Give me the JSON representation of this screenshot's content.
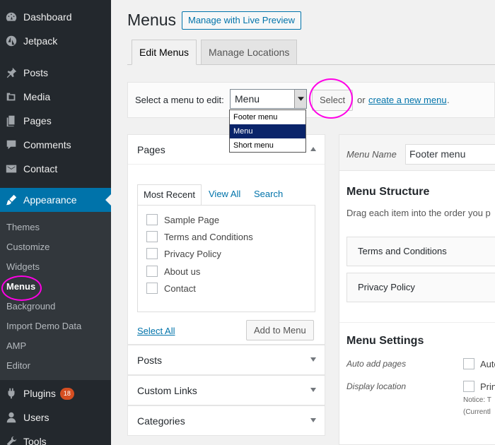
{
  "sidebar": {
    "items": [
      {
        "label": "Dashboard",
        "icon": "dashboard-icon"
      },
      {
        "label": "Jetpack",
        "icon": "jetpack-icon"
      },
      {
        "label": "Posts",
        "icon": "pin-icon"
      },
      {
        "label": "Media",
        "icon": "media-icon"
      },
      {
        "label": "Pages",
        "icon": "pages-icon"
      },
      {
        "label": "Comments",
        "icon": "comments-icon"
      },
      {
        "label": "Contact",
        "icon": "mail-icon"
      },
      {
        "label": "Appearance",
        "icon": "brush-icon"
      },
      {
        "label": "Plugins",
        "icon": "plugin-icon",
        "badge": "18"
      },
      {
        "label": "Users",
        "icon": "user-icon"
      },
      {
        "label": "Tools",
        "icon": "wrench-icon"
      }
    ],
    "appearance_submenu": [
      "Themes",
      "Customize",
      "Widgets",
      "Menus",
      "Background",
      "Import Demo Data",
      "AMP",
      "Editor"
    ]
  },
  "header": {
    "title": "Menus",
    "live_preview": "Manage with Live Preview"
  },
  "tabs": [
    "Edit Menus",
    "Manage Locations"
  ],
  "select_bar": {
    "label": "Select a menu to edit:",
    "current": "Menu",
    "options": [
      "Footer menu",
      "Menu",
      "Short menu"
    ],
    "button": "Select",
    "or_text": "or",
    "create_link": "create a new menu",
    "period": "."
  },
  "pages_box": {
    "title": "Pages",
    "tabs": [
      "Most Recent",
      "View All",
      "Search"
    ],
    "items": [
      "Sample Page",
      "Terms and Conditions",
      "Privacy Policy",
      "About us",
      "Contact"
    ],
    "select_all": "Select All",
    "add_button": "Add to Menu"
  },
  "collapsed_boxes": [
    "Posts",
    "Custom Links",
    "Categories"
  ],
  "menu_editor": {
    "name_label": "Menu Name",
    "name_value": "Footer menu",
    "structure_title": "Menu Structure",
    "drag_text": "Drag each item into the order you p",
    "items": [
      "Terms and Conditions",
      "Privacy Policy"
    ],
    "settings_title": "Menu Settings",
    "auto_add_label": "Auto add pages",
    "auto_add_text": "Auto",
    "display_label": "Display location",
    "display_text": "Prin",
    "notice_1": "Notice: T",
    "notice_2": "(Currentl"
  },
  "colors": {
    "sidebar_bg": "#23282d",
    "accent": "#0073aa",
    "highlight": "#ff00e6"
  }
}
